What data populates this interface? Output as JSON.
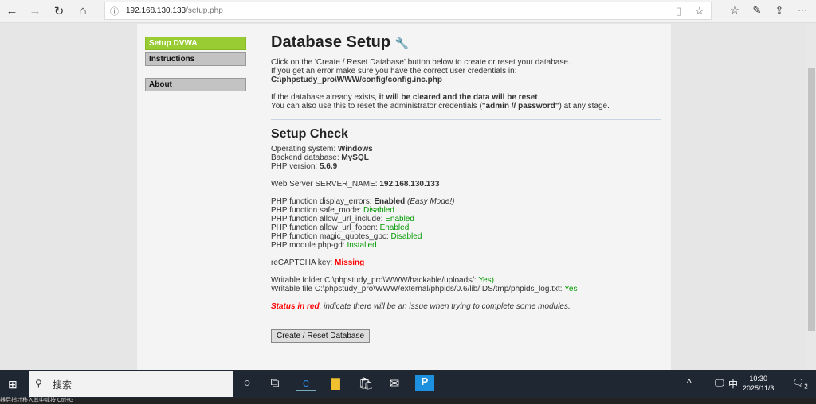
{
  "browser": {
    "url_host": "192.168.130.133",
    "url_path": "/setup.php"
  },
  "sidebar": {
    "items": [
      {
        "label": "Setup DVWA"
      },
      {
        "label": "Instructions"
      },
      {
        "label": "About"
      }
    ]
  },
  "main": {
    "title": "Database Setup",
    "intro1": "Click on the 'Create / Reset Database' button below to create or reset your database.",
    "intro2": "If you get an error make sure you have the correct user credentials in:",
    "config_path": "C:\\phpstudy_pro\\WWW/config/config.inc.php",
    "exists_prefix": "If the database already exists, ",
    "exists_bold": "it will be cleared and the data will be reset",
    "exists_suffix": ".",
    "admin_prefix": "You can also use this to reset the administrator credentials (",
    "admin_bold": "\"admin // password\"",
    "admin_suffix": ") at any stage.",
    "check_title": "Setup Check",
    "os_label": "Operating system: ",
    "os": "Windows",
    "db_label": "Backend database: ",
    "db": "MySQL",
    "php_label": "PHP version: ",
    "php": "5.6.9",
    "server_label": "Web Server SERVER_NAME: ",
    "server": "192.168.130.133",
    "de_label": "PHP function display_errors: ",
    "de": "Enabled",
    "de_note": "(Easy Mode!)",
    "sm_label": "PHP function safe_mode: ",
    "sm": "Disabled",
    "aui_label": "PHP function allow_url_include: ",
    "aui": "Enabled",
    "auf_label": "PHP function allow_url_fopen: ",
    "auf": "Enabled",
    "mq_label": "PHP function magic_quotes_gpc: ",
    "mq": "Disabled",
    "gd_label": "PHP module php-gd: ",
    "gd": "Installed",
    "captcha_label": "reCAPTCHA key: ",
    "captcha": "Missing",
    "wf1_label": "Writable folder C:\\phpstudy_pro\\WWW/hackable/uploads/: ",
    "wf1": "Yes)",
    "wf2_label": "Writable file C:\\phpstudy_pro\\WWW/external/phpids/0.6/lib/IDS/tmp/phpids_log.txt: ",
    "wf2": "Yes",
    "status_red": "Status in red",
    "status_note": ", indicate there will be an issue when trying to complete some modules.",
    "button": "Create / Reset Database"
  },
  "taskbar": {
    "search": "搜索",
    "ime": "中",
    "time": "10:30",
    "date": "2025/11/3",
    "notifications": "2"
  },
  "statusbar": "器后指针移入其中或按 Ctrl+G",
  "colors": {
    "accent": "#99cc33",
    "ok": "#009900",
    "error": "#ff0000"
  }
}
